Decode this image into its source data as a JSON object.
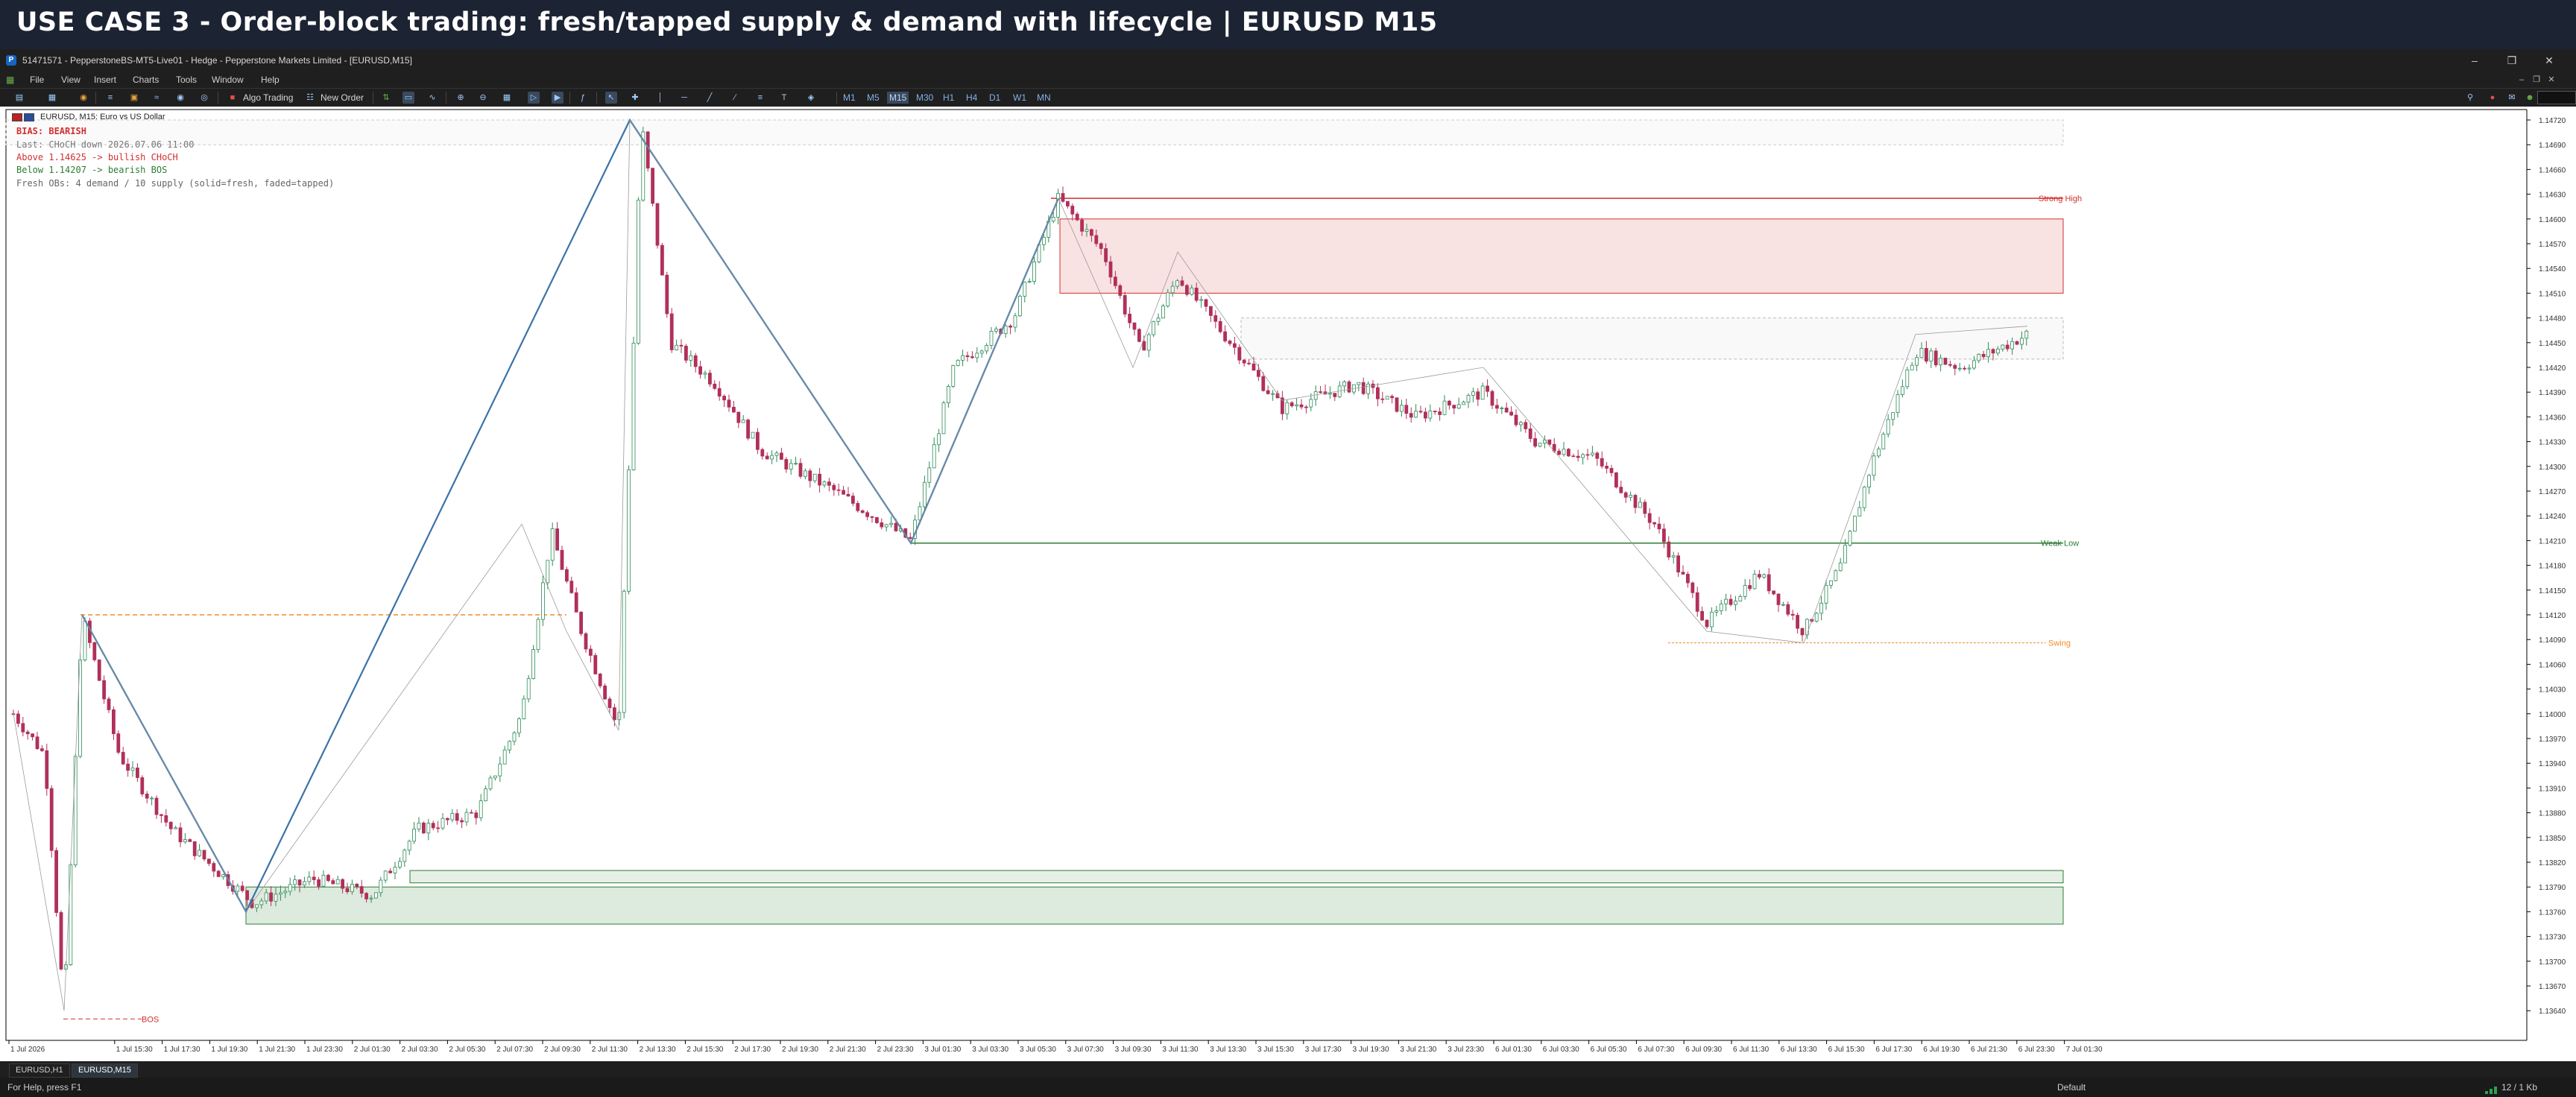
{
  "banner": {
    "title": "USE CASE 3 - Order-block trading: fresh/tapped supply & demand with lifecycle  |  EURUSD M15"
  },
  "window": {
    "title": "51471571 - PepperstoneBS-MT5-Live01 - Hedge - Pepperstone Markets Limited - [EURUSD,M15]"
  },
  "menu": [
    "File",
    "View",
    "Insert",
    "Charts",
    "Tools",
    "Window",
    "Help"
  ],
  "toolbar": {
    "algo_trading": "Algo Trading",
    "new_order": "New Order",
    "timeframes": [
      "M1",
      "M5",
      "M15",
      "M30",
      "H1",
      "H4",
      "D1",
      "W1",
      "MN"
    ],
    "active_timeframe": "M15"
  },
  "chart": {
    "symbol_label": "EURUSD, M15: Euro vs US Dollar",
    "info_lines": [
      {
        "text": "BIAS: BEARISH",
        "color": "#d32f2f"
      },
      {
        "text": "Last: CHoCH down  2026.07.06 11:00",
        "color": "#777777"
      },
      {
        "text": "Above 1.14625  ->  bullish CHoCH",
        "color": "#d32f2f"
      },
      {
        "text": "Below 1.14207  ->  bearish BOS",
        "color": "#2e7d32"
      },
      {
        "text": "Fresh OBs: 4 demand / 10 supply   (solid=fresh, faded=tapped)",
        "color": "#666666"
      }
    ],
    "levels": {
      "strong_high": {
        "label": "Strong High",
        "price": 1.14625
      },
      "weak_low": {
        "label": "Weak Low",
        "price": 1.14207
      },
      "swing": {
        "label": "Swing",
        "price": 1.14086
      },
      "bos": {
        "label": "BOS",
        "price": 1.1363
      }
    },
    "price_axis": [
      "1.14720",
      "1.14690",
      "1.14660",
      "1.14630",
      "1.14600",
      "1.14570",
      "1.14540",
      "1.14510",
      "1.14480",
      "1.14450",
      "1.14420",
      "1.14390",
      "1.14360",
      "1.14330",
      "1.14300",
      "1.14270",
      "1.14240",
      "1.14210",
      "1.14180",
      "1.14150",
      "1.14120",
      "1.14090",
      "1.14060",
      "1.14030",
      "1.14000",
      "1.13970",
      "1.13940",
      "1.13910",
      "1.13880",
      "1.13850",
      "1.13820",
      "1.13790",
      "1.13760",
      "1.13730",
      "1.13700",
      "1.13670",
      "1.13640"
    ],
    "time_axis": [
      "1 Jul 2026",
      "1 Jul 15:30",
      "1 Jul 17:30",
      "1 Jul 19:30",
      "1 Jul 21:30",
      "1 Jul 23:30",
      "2 Jul 01:30",
      "2 Jul 03:30",
      "2 Jul 05:30",
      "2 Jul 07:30",
      "2 Jul 09:30",
      "2 Jul 11:30",
      "2 Jul 13:30",
      "2 Jul 15:30",
      "2 Jul 17:30",
      "2 Jul 19:30",
      "2 Jul 21:30",
      "2 Jul 23:30",
      "3 Jul 01:30",
      "3 Jul 03:30",
      "3 Jul 05:30",
      "3 Jul 07:30",
      "3 Jul 09:30",
      "3 Jul 11:30",
      "3 Jul 13:30",
      "3 Jul 15:30",
      "3 Jul 17:30",
      "3 Jul 19:30",
      "3 Jul 21:30",
      "3 Jul 23:30",
      "6 Jul 01:30",
      "6 Jul 03:30",
      "6 Jul 05:30",
      "6 Jul 07:30",
      "6 Jul 09:30",
      "6 Jul 11:30",
      "6 Jul 13:30",
      "6 Jul 15:30",
      "6 Jul 17:30",
      "6 Jul 19:30",
      "6 Jul 21:30",
      "6 Jul 23:30",
      "7 Jul 01:30"
    ],
    "colors": {
      "bull": "#2e8b57",
      "bear": "#b0305a",
      "zigzag": "#3a73a8",
      "supply": "#d32f2f",
      "demand": "#2e7d32",
      "swing": "#f08c28"
    }
  },
  "tabs": [
    "EURUSD,H1",
    "EURUSD,M15"
  ],
  "active_tab": "EURUSD,M15",
  "status": {
    "help": "For Help, press F1",
    "profile": "Default",
    "traffic": "12 / 1 Kb"
  }
}
